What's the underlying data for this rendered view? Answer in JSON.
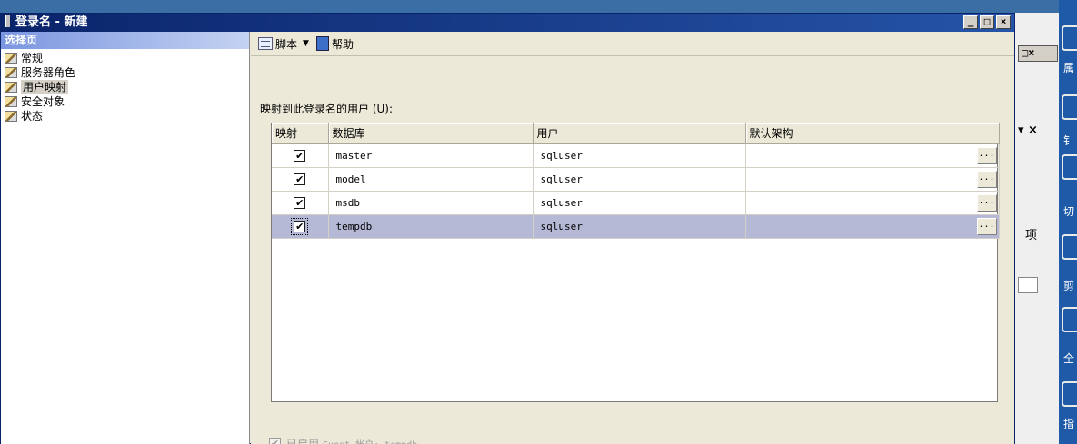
{
  "dialog": {
    "title": "登录名 - 新建",
    "buttons": {
      "minimize": "_",
      "maximize": "□",
      "close": "×"
    }
  },
  "left_pane": {
    "header": "选择页",
    "pages": [
      {
        "label": "常规",
        "selected": false
      },
      {
        "label": "服务器角色",
        "selected": false
      },
      {
        "label": "用户映射",
        "selected": true
      },
      {
        "label": "安全对象",
        "selected": false
      },
      {
        "label": "状态",
        "selected": false
      }
    ]
  },
  "toolbar": {
    "script_label": "脚本",
    "dropdown_arrow": "▼",
    "help_label": "帮助"
  },
  "mapping": {
    "label": "映射到此登录名的用户 (U):",
    "columns": [
      "映射",
      "数据库",
      "用户",
      "默认架构"
    ],
    "rows": [
      {
        "mapped": "✔",
        "database": "master",
        "user": "sqluser",
        "schema": "",
        "button": "..."
      },
      {
        "mapped": "✔",
        "database": "model",
        "user": "sqluser",
        "schema": "",
        "button": "..."
      },
      {
        "mapped": "✔",
        "database": "msdb",
        "user": "sqluser",
        "schema": "",
        "button": "..."
      },
      {
        "mapped": "✔",
        "database": "tempdb",
        "user": "sqluser",
        "schema": "",
        "button": "...",
        "selected": true
      }
    ]
  },
  "guest": {
    "check": "✔",
    "label": "已启用",
    "detail": "Guest 帐户: tempdb"
  },
  "background": {
    "window_buttons": "□×",
    "dropdown_close": "▾ ×",
    "item_label": "项",
    "side_labels": [
      "属",
      "钅",
      "切",
      "剪",
      "全",
      "指"
    ]
  },
  "colors": {
    "title_bar": "#0a246a",
    "selected_row": "#b5b9d6",
    "dialog_bg": "#ece9d8"
  }
}
